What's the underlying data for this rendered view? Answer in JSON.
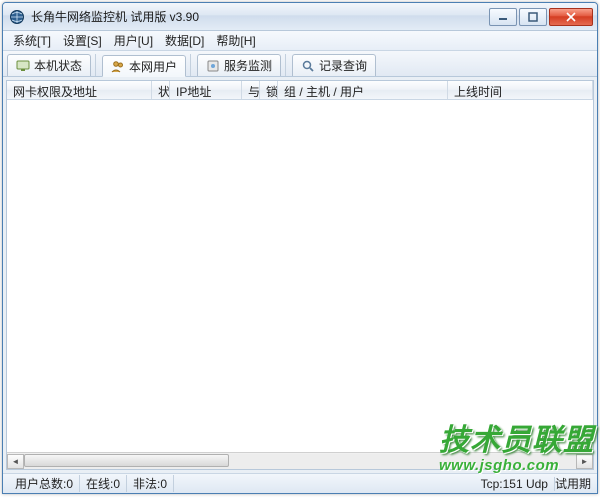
{
  "window": {
    "title": "长角牛网络监控机 试用版 v3.90"
  },
  "menu": {
    "system": "系统[T]",
    "settings": "设置[S]",
    "users": "用户[U]",
    "data": "数据[D]",
    "help": "帮助[H]"
  },
  "tabs": {
    "local": "本机状态",
    "users": "本网用户",
    "service": "服务监测",
    "records": "记录查询"
  },
  "columns": {
    "c0": "网卡权限及地址",
    "c1": "状",
    "c2": "IP地址",
    "c3": "与",
    "c4": "锁",
    "c5": "组 / 主机 / 用户",
    "c6": "上线时间"
  },
  "status": {
    "users_total": "用户总数:0",
    "online": "在线:0",
    "illegal": "非法:0",
    "tcp_udp": "Tcp:151 Udp",
    "trial": "试用期"
  },
  "watermark": {
    "text": "技术员联盟",
    "url": "www.jsgho.com"
  }
}
